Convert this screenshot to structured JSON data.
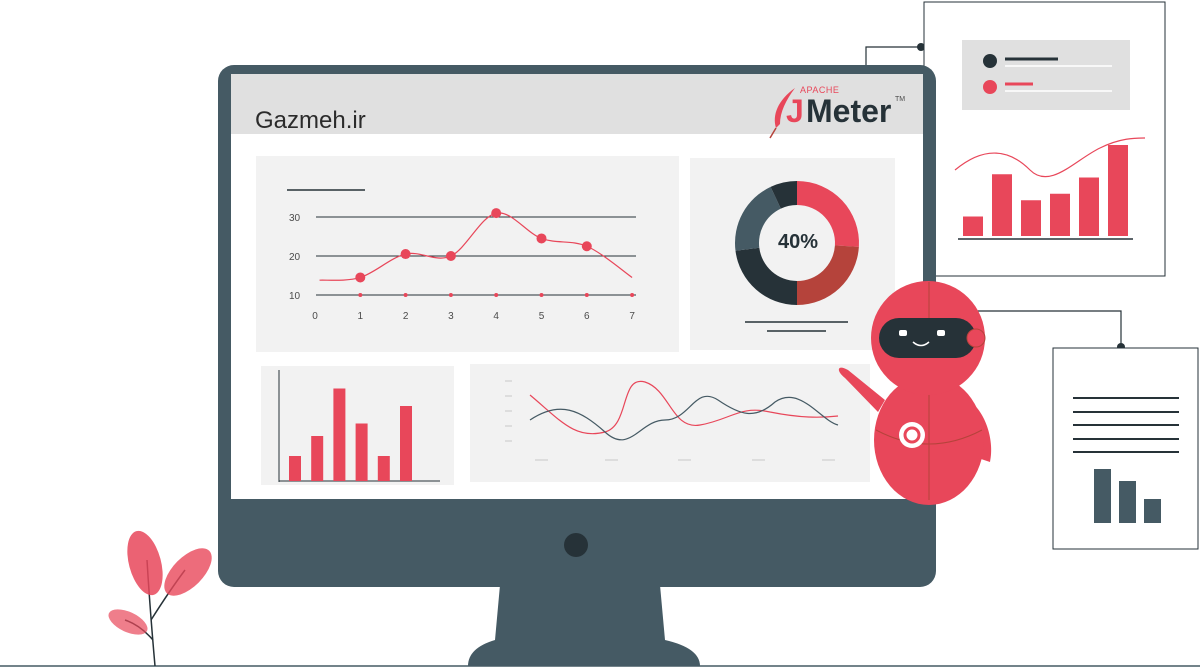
{
  "brand": {
    "site_name": "Gazmeh.ir",
    "product_prefix": "APACHE",
    "product_j": "J",
    "product_rest": "Meter",
    "product_tm": "TM",
    "logo_icon": "feather-icon"
  },
  "colors": {
    "accent_red": "#e8475a",
    "dark_slate": "#455a64",
    "near_black": "#263238",
    "brown_red": "#b5433b",
    "panel_gray": "#f2f2f2"
  },
  "donut": {
    "label": "40%",
    "segments": [
      {
        "color": "#e8475a",
        "value": 26
      },
      {
        "color": "#b5433b",
        "value": 24
      },
      {
        "color": "#263238",
        "value": 23
      },
      {
        "color": "#455a64",
        "value": 20
      },
      {
        "color": "#263238",
        "value": 7
      }
    ]
  },
  "chart_data": [
    {
      "type": "line",
      "title": "",
      "xlabel": "",
      "ylabel": "",
      "x_ticks": [
        "0",
        "1",
        "2",
        "3",
        "4",
        "5",
        "6",
        "7"
      ],
      "y_ticks": [
        "10",
        "20",
        "30"
      ],
      "ylim": [
        10,
        30
      ],
      "series": [
        {
          "x": [
            1,
            2,
            3,
            4,
            5,
            6
          ],
          "y": [
            14.5,
            20.5,
            20,
            31,
            24.5,
            22.5
          ]
        }
      ],
      "grid": true
    },
    {
      "type": "bar",
      "values": [
        5,
        9,
        18.5,
        11.5,
        5,
        15
      ]
    }
  ],
  "right_card_bars": [
    3,
    9.5,
    5.5,
    6.5,
    9,
    14
  ],
  "lower_card_bars": [
    9,
    7,
    4
  ]
}
